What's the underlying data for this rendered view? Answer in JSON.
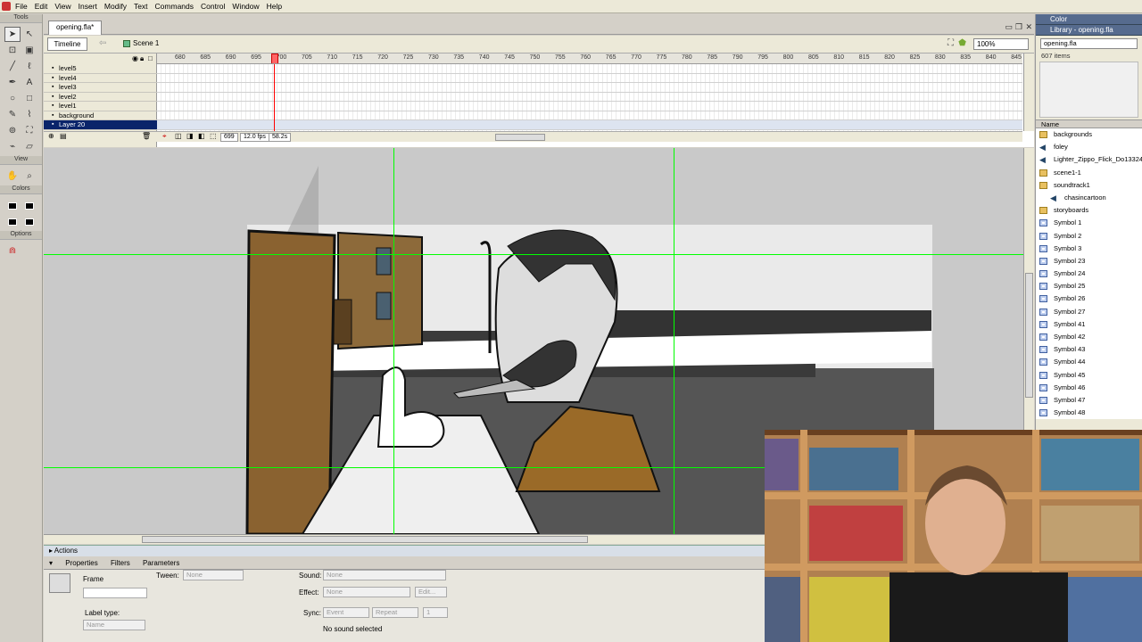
{
  "menu": [
    "File",
    "Edit",
    "View",
    "Insert",
    "Modify",
    "Text",
    "Commands",
    "Control",
    "Window",
    "Help"
  ],
  "tools": {
    "title": "Tools",
    "view_label": "View",
    "colors_label": "Colors",
    "options_label": "Options"
  },
  "document": {
    "tab_title": "opening.fla*",
    "timeline_button": "Timeline",
    "scene": "Scene 1",
    "zoom": "100%"
  },
  "timeline": {
    "ruler_ticks": [
      "680",
      "685",
      "690",
      "695",
      "700",
      "705",
      "710",
      "715",
      "720",
      "725",
      "730",
      "735",
      "740",
      "745",
      "750",
      "755",
      "760",
      "765",
      "770",
      "775",
      "780",
      "785",
      "790",
      "795",
      "800",
      "805",
      "810",
      "815",
      "820",
      "825",
      "830",
      "835",
      "840",
      "845"
    ],
    "layers": [
      {
        "name": "level5"
      },
      {
        "name": "level4"
      },
      {
        "name": "level3"
      },
      {
        "name": "level2"
      },
      {
        "name": "level1"
      },
      {
        "name": "background"
      },
      {
        "name": "Layer 20"
      }
    ],
    "current_frame": "699",
    "fps": "12.0 fps",
    "time": "58.2s"
  },
  "panels": {
    "actions_label": "Actions",
    "tabs": [
      "Properties",
      "Filters",
      "Parameters"
    ]
  },
  "properties": {
    "frame_label": "Frame",
    "tween_label": "Tween:",
    "tween_value": "None",
    "sound_label": "Sound:",
    "sound_value": "None",
    "effect_label": "Effect:",
    "effect_value": "None",
    "edit_button": "Edit...",
    "sync_label": "Sync:",
    "sync_value": "Event",
    "repeat_value": "Repeat",
    "repeat_count": "1",
    "label_type_label": "Label type:",
    "label_type_value": "Name",
    "sound_status": "No sound selected"
  },
  "library": {
    "color_panel": "Color",
    "library_panel": "Library - opening.fla",
    "selected_file": "opening.fla",
    "item_count": "607 items",
    "column_name": "Name",
    "items": [
      {
        "name": "backgrounds",
        "icon": "folder-icon"
      },
      {
        "name": "foley",
        "icon": "sound-icon"
      },
      {
        "name": "Lighter_Zippo_Flick_Do13324",
        "icon": "sound-icon"
      },
      {
        "name": "scene1-1",
        "icon": "folder-icon"
      },
      {
        "name": "soundtrack1",
        "icon": "folder-open-icon"
      },
      {
        "name": "chasincartoon",
        "icon": "sound-icon"
      },
      {
        "name": "storyboards",
        "icon": "folder-icon"
      },
      {
        "name": "Symbol 1",
        "icon": "symbol-icon"
      },
      {
        "name": "Symbol 2",
        "icon": "symbol-icon"
      },
      {
        "name": "Symbol 3",
        "icon": "symbol-icon"
      },
      {
        "name": "Symbol 23",
        "icon": "symbol-icon"
      },
      {
        "name": "Symbol 24",
        "icon": "symbol-icon"
      },
      {
        "name": "Symbol 25",
        "icon": "symbol-icon"
      },
      {
        "name": "Symbol 26",
        "icon": "symbol-icon"
      },
      {
        "name": "Symbol 27",
        "icon": "symbol-icon"
      },
      {
        "name": "Symbol 41",
        "icon": "symbol-icon"
      },
      {
        "name": "Symbol 42",
        "icon": "symbol-icon"
      },
      {
        "name": "Symbol 43",
        "icon": "symbol-icon"
      },
      {
        "name": "Symbol 44",
        "icon": "symbol-icon"
      },
      {
        "name": "Symbol 45",
        "icon": "symbol-icon"
      },
      {
        "name": "Symbol 46",
        "icon": "symbol-icon"
      },
      {
        "name": "Symbol 47",
        "icon": "symbol-icon"
      },
      {
        "name": "Symbol 48",
        "icon": "symbol-icon"
      }
    ]
  },
  "colors": {
    "panel_header": "#566b8e",
    "selected_layer": "#0a246a",
    "guide": "#00ff00",
    "playhead": "#ff0000"
  }
}
